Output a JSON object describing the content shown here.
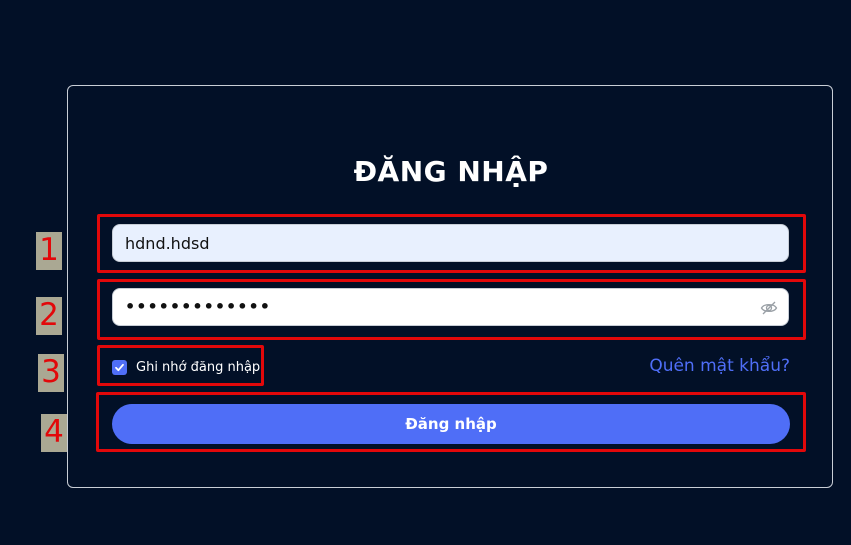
{
  "login": {
    "title": "ĐĂNG NHẬP",
    "username_value": "hdnd.hdsd",
    "password_masked": "•••••••••••••",
    "remember_label": "Ghi nhớ đăng nhập",
    "remember_checked": true,
    "forgot_link": "Quên mật khẩu?",
    "submit_label": "Đăng nhập",
    "icons": {
      "password_toggle": "eye-slash-icon",
      "checkbox": "checkmark-icon"
    }
  },
  "annotations": {
    "markers": [
      "1",
      "2",
      "3",
      "4"
    ],
    "highlight_color": "#e2080a"
  },
  "colors": {
    "background": "#021027",
    "accent": "#4f6ef7",
    "username_fill": "#e8f0fe"
  }
}
